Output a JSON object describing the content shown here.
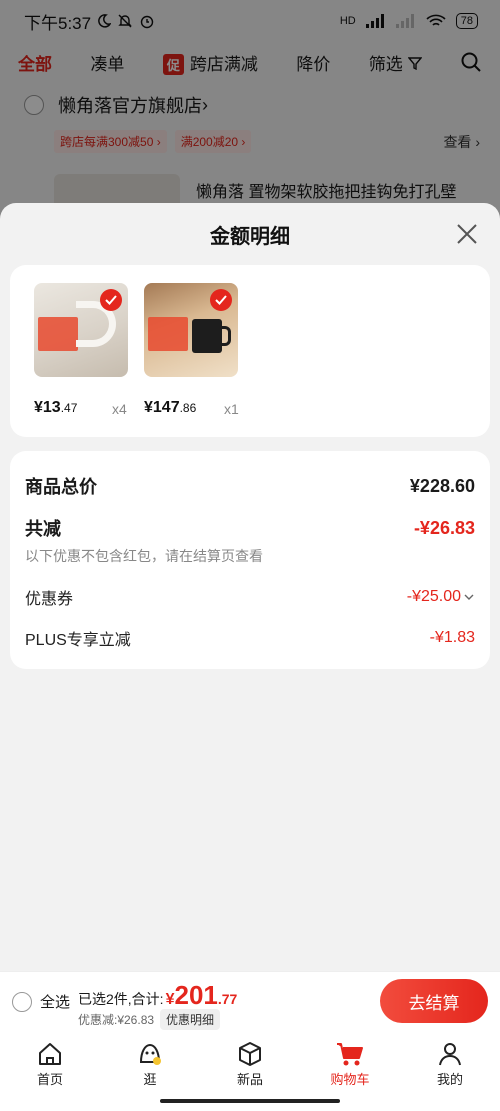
{
  "status_bar": {
    "time": "下午5:37",
    "signal_label": "HD",
    "battery": "78"
  },
  "background_page": {
    "tabs": [
      {
        "label": "全部",
        "active": true
      },
      {
        "label": "凑单"
      },
      {
        "label": "跨店满减",
        "tag": "促"
      },
      {
        "label": "降价"
      },
      {
        "label": "筛选"
      }
    ],
    "store": {
      "name": "懒角落官方旗舰店",
      "chevron": "›",
      "promos": [
        "跨店每满300减50 ›",
        "满200减20 ›"
      ],
      "see_more": "查看 ›"
    },
    "product_title": "懒角落 置物架软胶拖把挂钩免打孔壁"
  },
  "sheet": {
    "title": "金额明细",
    "products": [
      {
        "price_main": "¥13",
        "price_cents": ".47",
        "qty": "x4",
        "image": "hook-product"
      },
      {
        "price_main": "¥147",
        "price_cents": ".86",
        "qty": "x1",
        "image": "mug-product"
      }
    ],
    "summary": {
      "total_label": "商品总价",
      "total_value": "¥228.60",
      "discount_label": "共减",
      "discount_value": "-¥26.83",
      "discount_note": "以下优惠不包含红包，请在结算页查看",
      "coupon_label": "优惠券",
      "coupon_value": "-¥25.00",
      "plus_label": "PLUS专享立减",
      "plus_value": "-¥1.83"
    }
  },
  "checkout": {
    "select_all": "全选",
    "selected_text": "已选2件,合计:",
    "total_yen": "¥",
    "total_main": "201",
    "total_cents": ".77",
    "discount_text": "优惠减:¥26.83",
    "detail_pill": "优惠明细",
    "submit": "去结算"
  },
  "tabbar": [
    {
      "label": "首页",
      "icon": "home-icon"
    },
    {
      "label": "逛",
      "icon": "browse-icon"
    },
    {
      "label": "新品",
      "icon": "box-icon"
    },
    {
      "label": "购物车",
      "icon": "cart-icon",
      "active": true
    },
    {
      "label": "我的",
      "icon": "user-icon"
    }
  ],
  "colors": {
    "accent": "#e4261d",
    "sheet_bg": "#f2f2f2"
  }
}
